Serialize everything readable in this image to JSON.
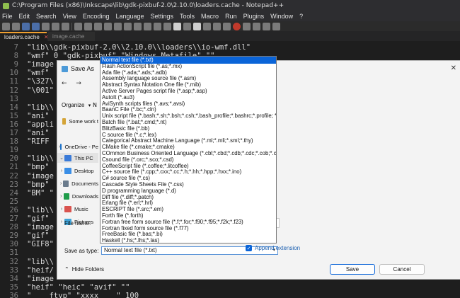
{
  "window": {
    "title": "C:\\Program Files (x86)\\Inkscape\\lib\\gdk-pixbuf-2.0\\2.10.0\\loaders.cache - Notepad++"
  },
  "menu": [
    "File",
    "Edit",
    "Search",
    "View",
    "Encoding",
    "Language",
    "Settings",
    "Tools",
    "Macro",
    "Run",
    "Plugins",
    "Window",
    "?"
  ],
  "tabs": [
    {
      "label": "loaders.cache",
      "active": true
    },
    {
      "label": "image.cache",
      "active": false
    }
  ],
  "editor": {
    "lines": [
      {
        "num": "7",
        "text": "\"lib\\\\gdk-pixbuf-2.0\\\\2.10.0\\\\loaders\\\\io-wmf.dll\""
      },
      {
        "num": "8",
        "text": "\"wmf\" 0 \"gdk-pixbuf\" \"Windows Metafile\" \"\""
      },
      {
        "num": "9",
        "text": "\"image"
      },
      {
        "num": "10",
        "text": "\"wmf\""
      },
      {
        "num": "11",
        "text": "\"\\327\\"
      },
      {
        "num": "12",
        "text": "\"\\001\""
      },
      {
        "num": "13",
        "text": ""
      },
      {
        "num": "14",
        "text": "\"lib\\\\"
      },
      {
        "num": "15",
        "text": "\"ani\""
      },
      {
        "num": "16",
        "text": "\"appli"
      },
      {
        "num": "17",
        "text": "\"ani\""
      },
      {
        "num": "18",
        "text": "\"RIFF"
      },
      {
        "num": "19",
        "text": ""
      },
      {
        "num": "20",
        "text": "\"lib\\\\"
      },
      {
        "num": "21",
        "text": "\"bmp\""
      },
      {
        "num": "22",
        "text": "\"image"
      },
      {
        "num": "23",
        "text": "\"bmp\""
      },
      {
        "num": "24",
        "text": "\"BM\" \""
      },
      {
        "num": "25",
        "text": ""
      },
      {
        "num": "26",
        "text": "\"lib\\\\"
      },
      {
        "num": "27",
        "text": "\"gif\""
      },
      {
        "num": "28",
        "text": "\"image"
      },
      {
        "num": "29",
        "text": "\"gif\""
      },
      {
        "num": "30",
        "text": "\"GIF8\""
      },
      {
        "num": "31",
        "text": ""
      },
      {
        "num": "32",
        "text": "\"lib\\\\"
      },
      {
        "num": "33",
        "text": "\"heif/"
      },
      {
        "num": "34",
        "text": "\"image"
      },
      {
        "num": "35",
        "text": "\"heif\" \"heic\" \"avif\" \"\""
      },
      {
        "num": "36",
        "text": "\"    ftyp\" \"xxxx    \" 100"
      }
    ]
  },
  "dialog": {
    "title": "Save As",
    "organize": "Organize",
    "new_label": "N",
    "nav": [
      {
        "label": "Some work t",
        "color": "#d4a437",
        "chev": ""
      },
      {
        "label": "OneDrive - Pe",
        "color": "#1e73c9",
        "chev": "›"
      },
      {
        "label": "This PC",
        "color": "#3b7bd8",
        "chev": "⌄"
      },
      {
        "label": "Desktop",
        "color": "#3a8ee6",
        "chev": "›"
      },
      {
        "label": "Documents",
        "color": "#6a7b8c",
        "chev": "›"
      },
      {
        "label": "Downloads",
        "color": "#1f9c4a",
        "chev": "›"
      },
      {
        "label": "Music",
        "color": "#d9534f",
        "chev": "›"
      },
      {
        "label": "Pictures",
        "color": "#3fa3d8",
        "chev": "›"
      }
    ],
    "file_name_label": "File name:",
    "save_as_type_label": "Save as type:",
    "save_as_type_value": "Normal text file (*.txt)",
    "append_extension": "Append extension",
    "hide_folders": "Hide Folders",
    "save_button": "Save",
    "cancel_button": "Cancel",
    "file_types": [
      "Normal text file (*.txt)",
      "Flash ActionScript file (*.as;*.mx)",
      "Ada file (*.ada;*.ads;*.adb)",
      "Assembly language source file (*.asm)",
      "Abstract Syntax Notation One file (*.mib)",
      "Active Server Pages script file (*.asp;*.asp)",
      "AutoIt (*.au3)",
      "AviSynth scripts files (*.avs;*.avsi)",
      "BaanC File (*.bc;*.cln)",
      "Unix script file (*.bash;*.sh;*.bsh;*.csh;*.bash_profile;*.bashrc;*.profile; *.*.*)",
      "Batch file (*.bat;*.cmd;*.nt)",
      "BlitzBasic file (*.bb)",
      "C source file (*.c;*.lex)",
      "Categorical Abstract Machine Language (*.ml;*.mli;*.sml;*.thy)",
      "CMake file (*.cmake;*.cmake)",
      "COmmon Business Oriented Language (*.cbl;*.cbd;*.cdb;*.cdc;*.cob;*.cpy;*.copy;*.lst)",
      "Csound file (*.orc;*.sco;*.csd)",
      "CoffeeScript file (*.coffee;*.litcoffee)",
      "C++ source file (*.cpp;*.cxx;*.cc;*.h;*.hh;*.hpp;*.hxx;*.ino)",
      "C# source file (*.cs)",
      "Cascade Style Sheets File (*.css)",
      "D programming language (*.d)",
      "Diff file (*.diff;*.patch)",
      "Erlang file (*.erl;*.hrl)",
      "ESCRIPT file (*.src;*.em)",
      "Forth file (*.forth)",
      "Fortran free form source file (*.f;*.for;*.f90;*.f95;*.f2k;*.f23)",
      "Fortran fixed form source file (*.f77)",
      "FreeBasic file (*.bas;*.bi)",
      "Haskell (*.hs;*.lhs;*.las)"
    ]
  }
}
